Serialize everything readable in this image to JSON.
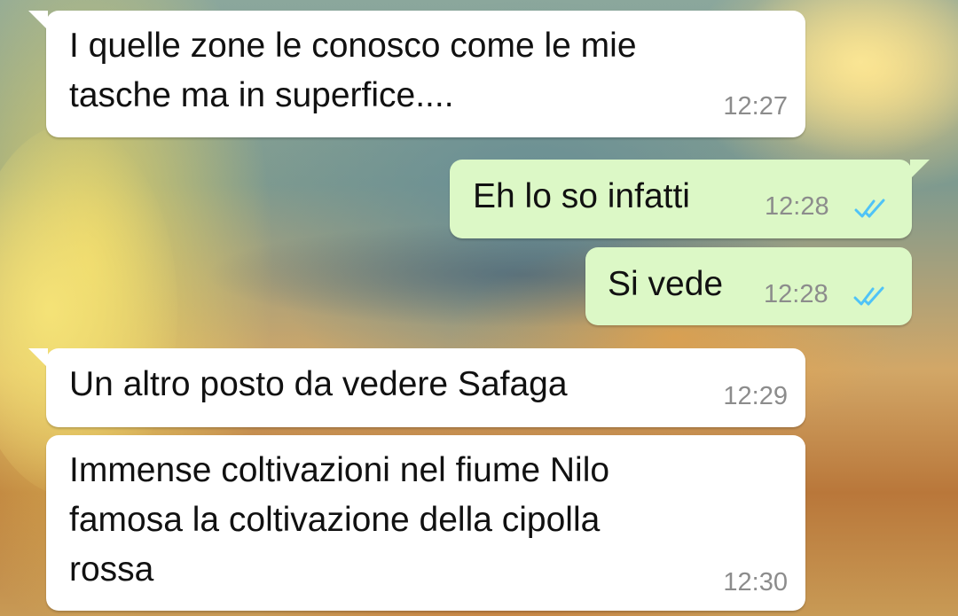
{
  "conversation": {
    "messages": [
      {
        "direction": "incoming",
        "text": "I quelle zone le conosco come le mie\ntasche ma in superfice....",
        "time": "12:27"
      },
      {
        "direction": "outgoing",
        "text": "Eh lo so infatti",
        "time": "12:28",
        "status": "read"
      },
      {
        "direction": "outgoing",
        "text": "Si vede",
        "time": "12:28",
        "status": "read"
      },
      {
        "direction": "incoming",
        "text": "Un altro posto da vedere Safaga",
        "time": "12:29"
      },
      {
        "direction": "incoming",
        "text": "Immense coltivazioni nel fiume Nilo\nfamosa la coltivazione della cipolla\nrossa",
        "time": "12:30"
      }
    ]
  },
  "colors": {
    "incoming_bubble": "#ffffff",
    "outgoing_bubble": "#dcf8c6",
    "read_ticks": "#4fc3f7",
    "timestamp": "#8c8c8c",
    "text": "#111111"
  },
  "icons": {
    "read_receipt": "double-check-icon"
  }
}
